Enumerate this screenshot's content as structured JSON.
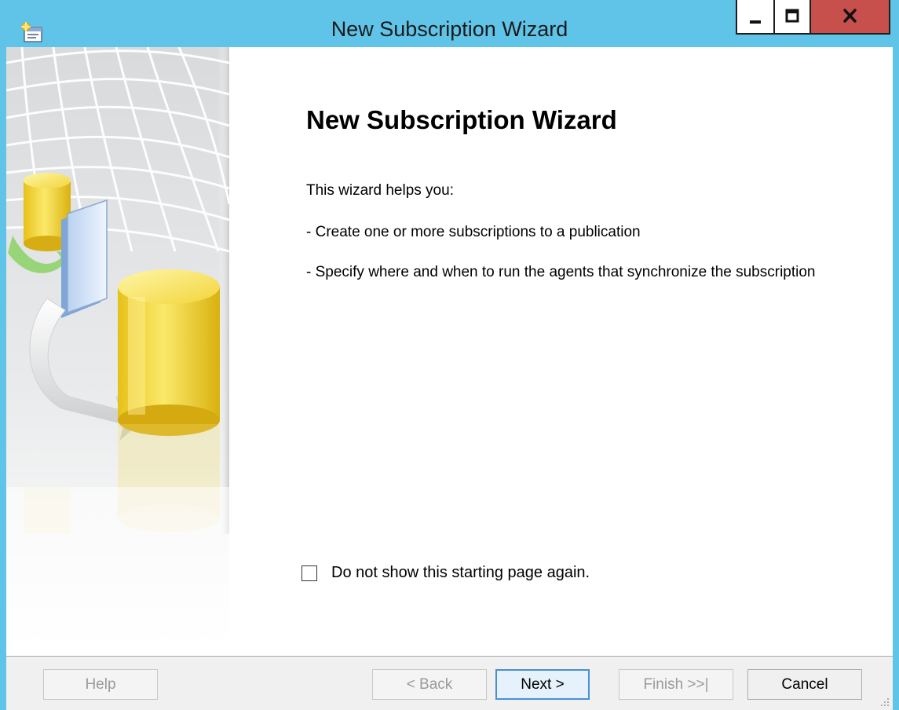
{
  "window": {
    "title": "New Subscription Wizard",
    "controls": {
      "minimize_glyph": "▁",
      "maximize_glyph": "□",
      "close_glyph": "x"
    }
  },
  "page": {
    "heading": "New Subscription Wizard",
    "intro": "This wizard helps you:",
    "bullets": [
      "- Create one or more subscriptions to a publication",
      "- Specify where and when to run the agents that synchronize the subscription"
    ],
    "checkbox": {
      "label": "Do not show this starting page again.",
      "checked": false
    }
  },
  "footer": {
    "help": "Help",
    "back": "< Back",
    "next": "Next >",
    "finish": "Finish >>|",
    "cancel": "Cancel"
  },
  "colors": {
    "titlebar": "#5fc4e8",
    "close_button": "#c7504d",
    "default_button_border": "#4a8fd4",
    "cylinder": "#f0d63a"
  },
  "icons": {
    "app": "wizard-app-icon",
    "side_art": "database-replication-illustration",
    "resize": "resize-grip-icon"
  }
}
